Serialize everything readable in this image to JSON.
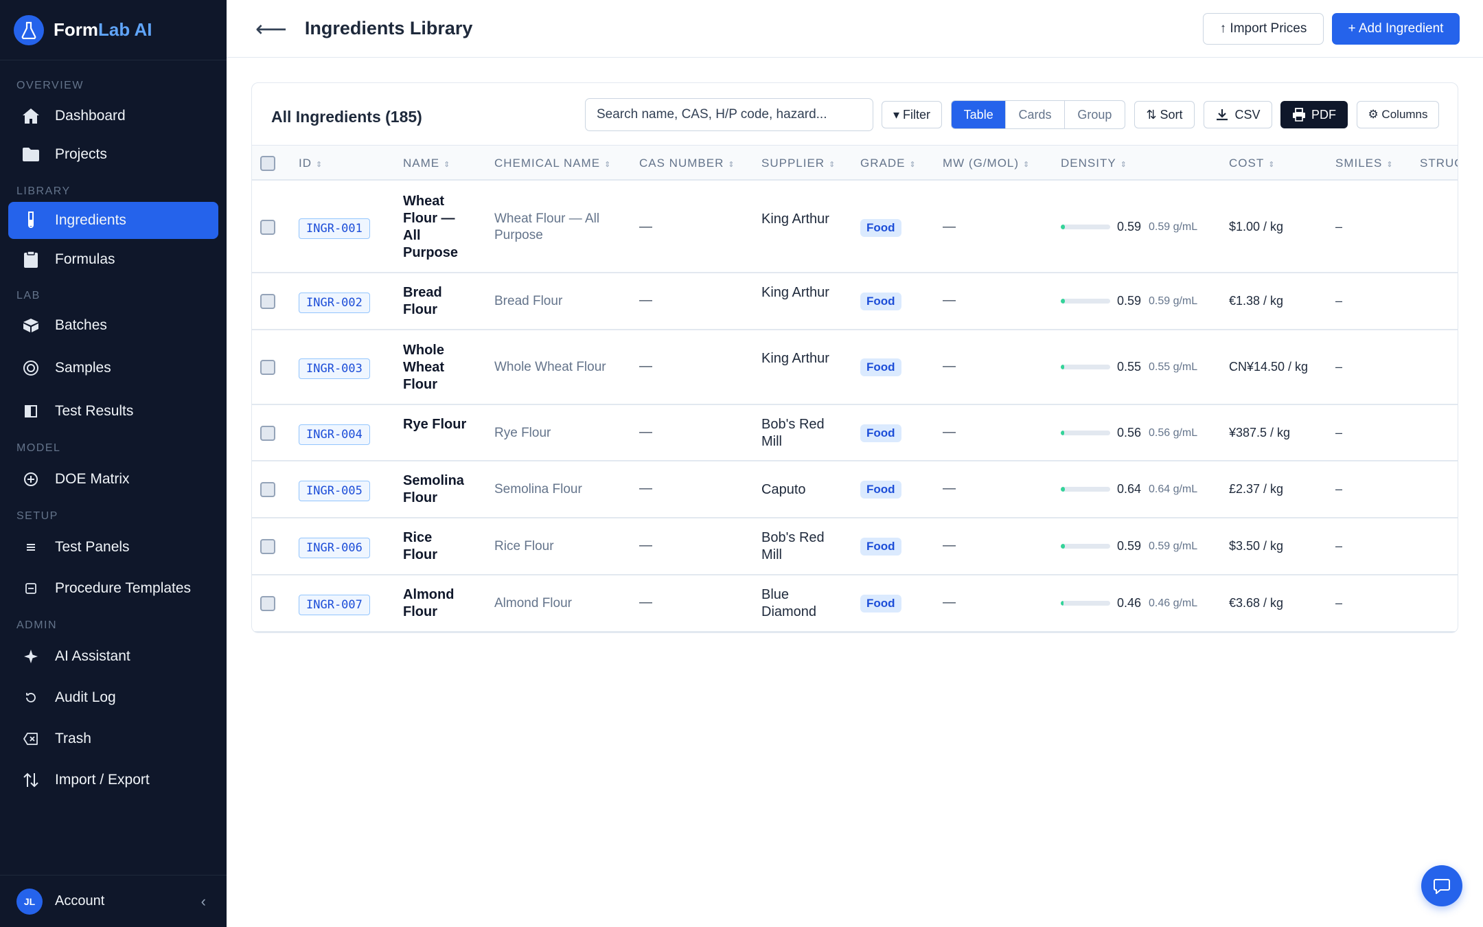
{
  "app": {
    "name_main": "Form",
    "name_accent": "Lab AI"
  },
  "sidebar": {
    "sections": [
      "OVERVIEW",
      "LIBRARY",
      "LAB",
      "MODEL",
      "SETUP",
      "ADMIN"
    ],
    "items": [
      {
        "label": "Dashboard",
        "icon": "home-icon"
      },
      {
        "label": "Projects",
        "icon": "folder-icon"
      },
      {
        "label": "Ingredients",
        "icon": "test-tube-icon",
        "active": true
      },
      {
        "label": "Formulas",
        "icon": "clipboard-icon"
      },
      {
        "label": "Batches",
        "icon": "box-icon"
      },
      {
        "label": "Samples",
        "icon": "circle-icon"
      },
      {
        "label": "Test Results",
        "icon": "square-half-icon"
      },
      {
        "label": "DOE Matrix",
        "icon": "plus-circle-icon"
      },
      {
        "label": "Test Panels",
        "icon": "list-icon"
      },
      {
        "label": "Procedure Templates",
        "icon": "template-icon"
      },
      {
        "label": "AI Assistant",
        "icon": "sparkle-icon"
      },
      {
        "label": "Audit Log",
        "icon": "history-icon"
      },
      {
        "label": "Trash",
        "icon": "trash-icon"
      },
      {
        "label": "Import / Export",
        "icon": "import-export-icon"
      }
    ],
    "account": {
      "initials": "JL",
      "label": "Account",
      "collapse": "‹"
    }
  },
  "header": {
    "back": "⟵",
    "title": "Ingredients Library",
    "import_label": "↑ Import Prices",
    "add_label": "+ Add Ingredient"
  },
  "toolbar": {
    "title": "All Ingredients (185)",
    "search_value": "Search name, CAS, H/P code, hazard...",
    "filter": "▾ Filter",
    "views": [
      "Table",
      "Cards",
      "Group"
    ],
    "active_view": "Table",
    "sort": "⇅ Sort",
    "csv": "CSV",
    "pdf": "PDF",
    "columns": "⚙ Columns"
  },
  "table": {
    "columns": [
      "ID",
      "NAME",
      "CHEMICAL NAME",
      "CAS NUMBER",
      "SUPPLIER",
      "GRADE",
      "MW (G/MOL)",
      "DENSITY",
      "COST",
      "SMILES",
      "STRUC"
    ],
    "sort_glyph": "⇕",
    "rows": [
      {
        "id": "INGR-001",
        "name": "Wheat Flour — All Purpose",
        "chem": "Wheat Flour — All Purpose",
        "cas": "—",
        "supplier": "King Arthur",
        "grade": "Food",
        "mw": "—",
        "density": "0.59",
        "density_unit": "0.59 g/mL",
        "density_level": 0.08,
        "cost": "$1.00 / kg",
        "smiles": "–"
      },
      {
        "id": "INGR-002",
        "name": "Bread Flour",
        "chem": "Bread Flour",
        "cas": "—",
        "supplier": "King Arthur",
        "grade": "Food",
        "mw": "—",
        "density": "0.59",
        "density_unit": "0.59 g/mL",
        "density_level": 0.08,
        "cost": "€1.38 / kg",
        "smiles": "–"
      },
      {
        "id": "INGR-003",
        "name": "Whole Wheat Flour",
        "chem": "Whole Wheat Flour",
        "cas": "—",
        "supplier": "King Arthur",
        "grade": "Food",
        "mw": "—",
        "density": "0.55",
        "density_unit": "0.55 g/mL",
        "density_level": 0.07,
        "cost": "CN¥14.50 / kg",
        "smiles": "–"
      },
      {
        "id": "INGR-004",
        "name": "Rye Flour",
        "chem": "Rye Flour",
        "cas": "—",
        "supplier": "Bob's Red Mill",
        "grade": "Food",
        "mw": "—",
        "density": "0.56",
        "density_unit": "0.56 g/mL",
        "density_level": 0.07,
        "cost": "¥387.5 / kg",
        "smiles": "–"
      },
      {
        "id": "INGR-005",
        "name": "Semolina Flour",
        "chem": "Semolina Flour",
        "cas": "—",
        "supplier": "Caputo",
        "grade": "Food",
        "mw": "—",
        "density": "0.64",
        "density_unit": "0.64 g/mL",
        "density_level": 0.09,
        "cost": "£2.37 / kg",
        "smiles": "–"
      },
      {
        "id": "INGR-006",
        "name": "Rice Flour",
        "chem": "Rice Flour",
        "cas": "—",
        "supplier": "Bob's Red Mill",
        "grade": "Food",
        "mw": "—",
        "density": "0.59",
        "density_unit": "0.59 g/mL",
        "density_level": 0.08,
        "cost": "$3.50 / kg",
        "smiles": "–"
      },
      {
        "id": "INGR-007",
        "name": "Almond Flour",
        "chem": "Almond Flour",
        "cas": "—",
        "supplier": "Blue Diamond",
        "grade": "Food",
        "mw": "—",
        "density": "0.46",
        "density_unit": "0.46 g/mL",
        "density_level": 0.06,
        "cost": "€3.68 / kg",
        "smiles": "–"
      }
    ]
  },
  "colors": {
    "sidebar_bg": "#0f172a",
    "accent": "#2563eb",
    "density_bar": "#34d399"
  }
}
